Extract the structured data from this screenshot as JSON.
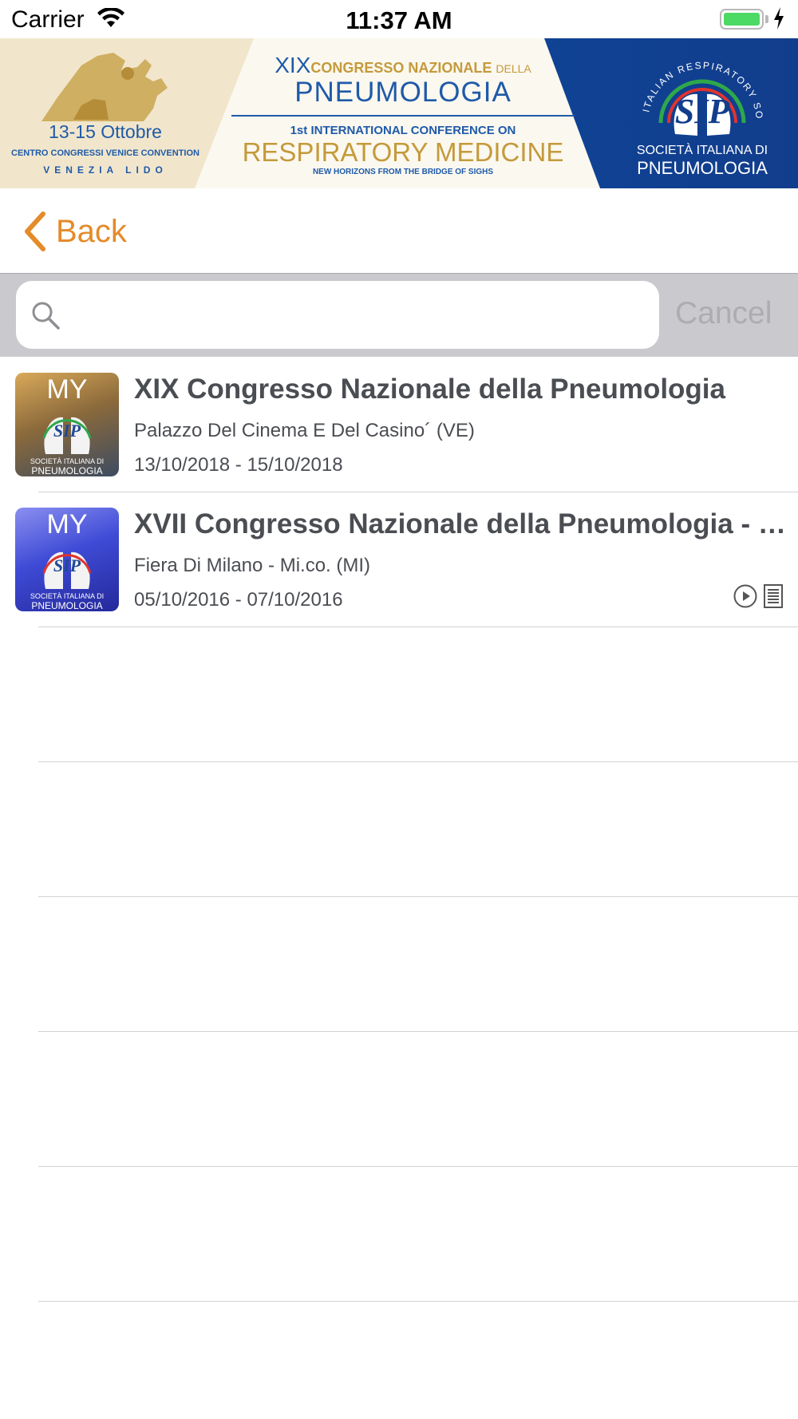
{
  "status_bar": {
    "carrier": "Carrier",
    "time": "11:37 AM",
    "battery_level": 1.0,
    "icons": [
      "wifi-icon",
      "battery-icon",
      "charging-bolt-icon"
    ]
  },
  "banner": {
    "dates": "13-15 Ottobre",
    "centro": "CENTRO CONGRESSI VENICE CONVENTION",
    "lido": "VENEZIA LIDO",
    "edition": "XIX",
    "congress_line": "CONGRESSO NAZIONALE",
    "della": "DELLA",
    "pneumologia": "PNEUMOLOGIA",
    "intl_line": "1st INTERNATIONAL CONFERENCE ON",
    "respiratory": "RESPIRATORY MEDICINE",
    "tagline": "NEW HORIZONS FROM THE BRIDGE OF SIGHS",
    "logo_ring_text": "ITALIAN RESPIRATORY SOCIETY",
    "logo_text": "SIP",
    "society": "SOCIETÀ ITALIANA DI",
    "society_pneumo": "PNEUMOLOGIA"
  },
  "nav": {
    "back_label": "Back"
  },
  "search": {
    "placeholder": "",
    "value": "",
    "cancel_label": "Cancel"
  },
  "congresses": [
    {
      "title": "XIX Congresso Nazionale della Pneumologia",
      "venue": "Palazzo Del Cinema E Del Casino´ (VE)",
      "dates": "13/10/2018 - 15/10/2018",
      "thumb": {
        "my": "MY",
        "sip": "SIP",
        "society": "SOCIETÀ ITALIANA DI",
        "pneumo": "PNEUMOLOGIA"
      },
      "icons": []
    },
    {
      "title": "XVII Congresso Nazionale della Pneumologia - Congresso Europeo",
      "venue": "Fiera Di Milano - Mi.co. (MI)",
      "dates": "05/10/2016 - 07/10/2016",
      "thumb": {
        "my": "MY",
        "sip": "SIP",
        "society": "SOCIETÀ ITALIANA DI",
        "pneumo": "PNEUMOLOGIA"
      },
      "icons": [
        "play-circle-icon",
        "document-icon"
      ]
    }
  ],
  "colors": {
    "accent": "#e48b2a",
    "text": "#4a4d52",
    "search_bar_bg": "#c9c9ce",
    "cancel_disabled": "#adadb1",
    "separator": "#d2d2d6"
  }
}
